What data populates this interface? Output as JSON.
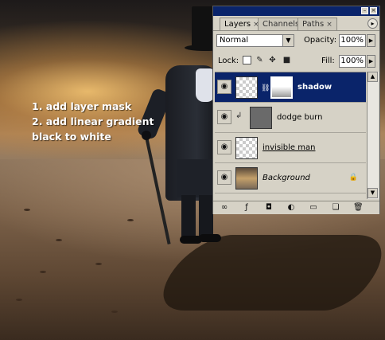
{
  "annotation": {
    "lines": [
      "1. add layer mask",
      "2. add linear gradient",
      "black to white"
    ]
  },
  "panel": {
    "tabs": [
      {
        "label": "Layers",
        "active": true
      },
      {
        "label": "Channels",
        "active": false
      },
      {
        "label": "Paths",
        "active": false
      }
    ],
    "blend_mode": "Normal",
    "opacity_label": "Opacity:",
    "opacity_value": "100%",
    "lock_label": "Lock:",
    "fill_label": "Fill:",
    "fill_value": "100%",
    "layers": [
      {
        "name": "shadow",
        "selected": true,
        "has_mask": true
      },
      {
        "name": "dodge burn",
        "clipped": true
      },
      {
        "name": "invisible man"
      },
      {
        "name": "Background",
        "locked": true
      }
    ]
  },
  "colors": {
    "titlebar": "#0a246a",
    "selected_layer": "#0a246a",
    "panel_bg": "#d6d2c6"
  }
}
